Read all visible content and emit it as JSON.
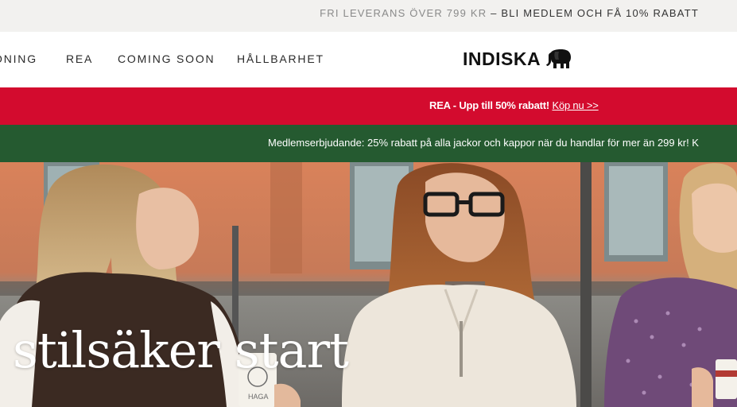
{
  "topbar": {
    "delivery": "FRI LEVERANS ÖVER 799 KR",
    "separator": " – ",
    "member": "BLI MEDLEM OCH FÅ 10% RABATT"
  },
  "nav": {
    "items": [
      {
        "label": "ONING"
      },
      {
        "label": "REA"
      },
      {
        "label": "COMING SOON"
      },
      {
        "label": "HÅLLBARHET"
      }
    ]
  },
  "logo": {
    "text": "INDISKA",
    "icon": "elephant-icon"
  },
  "sale_banner": {
    "text": "REA - Upp till 50% rabatt! ",
    "link": "Köp nu >>",
    "color": "#d30b2e"
  },
  "member_banner": {
    "text": "Medlemserbjudande: 25% rabatt på alla jackor och kappor när du handlar för mer än 299 kr! K",
    "color": "#255a30"
  },
  "hero": {
    "title": "stilsäker start",
    "subtitle": "",
    "cup_text": "HAGA"
  }
}
